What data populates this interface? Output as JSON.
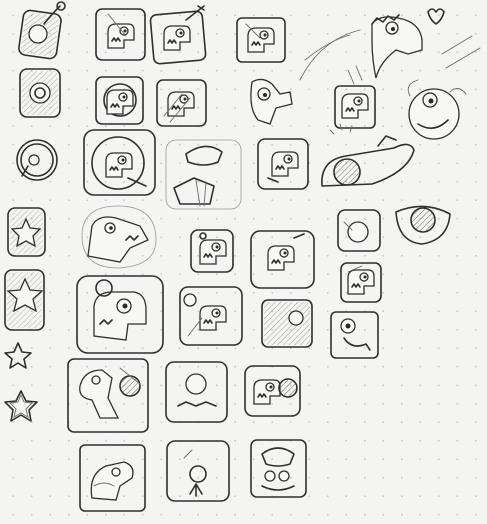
{
  "sketch": {
    "medium": "pencil",
    "paper": "dot-grid",
    "icons": [
      {
        "name": "bomb-icon"
      },
      {
        "name": "dino-icon"
      },
      {
        "name": "dino-icon"
      },
      {
        "name": "dino-icon"
      },
      {
        "name": "dino-icon"
      },
      {
        "name": "comet-dino"
      },
      {
        "name": "dino-icon"
      },
      {
        "name": "dino-icon"
      },
      {
        "name": "dino-icon"
      },
      {
        "name": "dino-icon"
      },
      {
        "name": "dino-icon"
      },
      {
        "name": "dino-icon"
      },
      {
        "name": "dino-icon"
      },
      {
        "name": "dino-icon"
      },
      {
        "name": "bomb-icon"
      },
      {
        "name": "dino-icon"
      },
      {
        "name": "star-icon"
      },
      {
        "name": "star-icon"
      }
    ]
  }
}
